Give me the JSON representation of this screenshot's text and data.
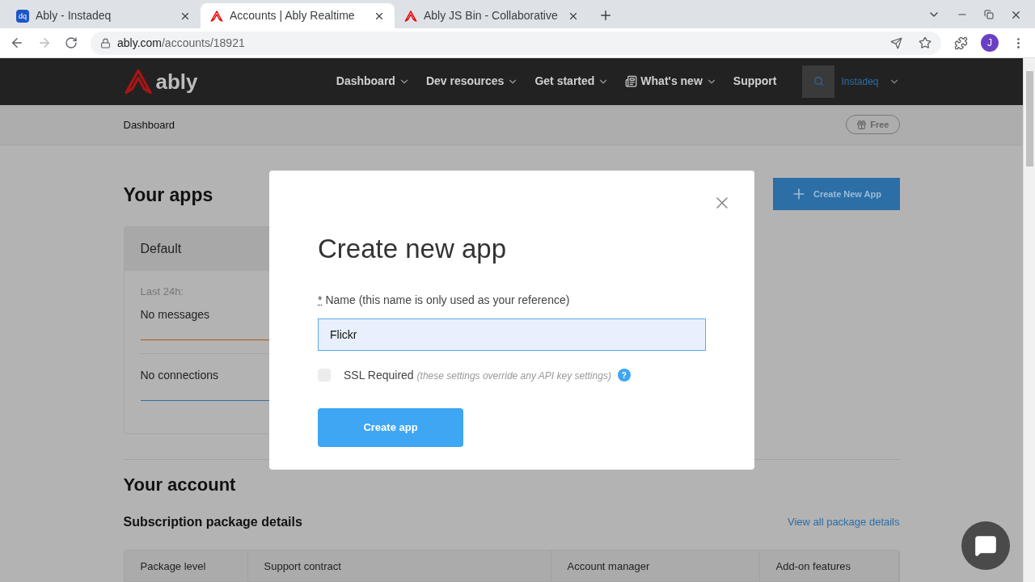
{
  "browser": {
    "tabs": [
      {
        "title": "Ably - Instadeq",
        "kind": "text",
        "favicon_text": "dq",
        "selected": false
      },
      {
        "title": "Accounts | Ably Realtime",
        "kind": "logo",
        "selected": true
      },
      {
        "title": "Ably JS Bin - Collaborative",
        "kind": "logo",
        "selected": false
      }
    ],
    "url_host": "ably.com",
    "url_path": "/accounts/18921",
    "avatar": "J"
  },
  "nav": {
    "logo": "ably",
    "items": [
      {
        "label": "Dashboard",
        "kind": "dropdown"
      },
      {
        "label": "Dev resources",
        "kind": "dropdown"
      },
      {
        "label": "Get started",
        "kind": "dropdown"
      },
      {
        "label": "What's new",
        "kind": "icon-dropdown"
      },
      {
        "label": "Support",
        "kind": "plain"
      }
    ],
    "account": "Instadeq"
  },
  "breadcrumb": {
    "label": "Dashboard",
    "plan": "Free"
  },
  "apps": {
    "title": "Your apps",
    "create_button": "Create New App",
    "card": {
      "name": "Default",
      "period": "Last 24h:",
      "stats": [
        "No messages",
        "No connections"
      ]
    }
  },
  "account": {
    "title": "Your account",
    "subtitle": "Subscription package details",
    "link": "View all package details",
    "columns": [
      "Package level",
      "Support contract",
      "Account manager",
      "Add-on features"
    ]
  },
  "modal": {
    "title": "Create new app",
    "required_mark": "*",
    "label": "Name (this name is only used as your reference)",
    "value": "Flickr",
    "ssl": {
      "label": "SSL Required",
      "note": "(these settings override any API key settings)",
      "checked": false,
      "help": "?"
    },
    "submit": "Create app"
  }
}
